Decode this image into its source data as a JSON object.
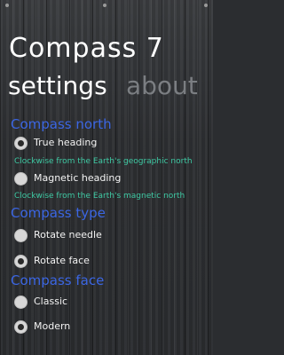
{
  "app": {
    "title": "Compass 7"
  },
  "pivot": {
    "settings": "settings",
    "about": "about"
  },
  "sections": {
    "north": {
      "title": "Compass north",
      "options": [
        {
          "label": "True heading",
          "checked": true,
          "description": "Clockwise from the Earth's geographic north"
        },
        {
          "label": "Magnetic heading",
          "checked": false,
          "description": "Clockwise from the Earth's magnetic north"
        }
      ]
    },
    "type": {
      "title": "Compass type",
      "options": [
        {
          "label": "Rotate needle",
          "checked": false
        },
        {
          "label": "Rotate face",
          "checked": true
        }
      ]
    },
    "face": {
      "title": "Compass face",
      "options": [
        {
          "label": "Classic",
          "checked": false
        },
        {
          "label": "Modern",
          "checked": true
        }
      ]
    }
  },
  "colors": {
    "accent": "#3b66e3",
    "description": "#3ec9a3",
    "inactive_pivot": "#7b7e82"
  }
}
